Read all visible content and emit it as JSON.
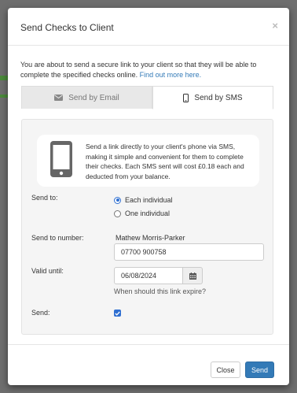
{
  "modal": {
    "title": "Send Checks to Client",
    "close_symbol": "×",
    "intro_text": "You are about to send a secure link to your client so that they will be able to complete the specified checks online.",
    "intro_link": "Find out more here."
  },
  "tabs": [
    {
      "label": "Send by Email",
      "icon": "envelope-icon",
      "active": false
    },
    {
      "label": "Send by SMS",
      "icon": "mobile-phone-icon",
      "active": true
    }
  ],
  "info": {
    "icon": "mobile-phone-icon",
    "text": "Send a link directly to your client's phone via SMS, making it simple and convenient for them to complete their checks. Each SMS sent will cost £0.18 each and deducted from your balance."
  },
  "form": {
    "send_to_label": "Send to:",
    "send_to_options": [
      {
        "label": "Each individual",
        "checked": true
      },
      {
        "label": "One individual",
        "checked": false
      }
    ],
    "send_to_number_label": "Send to number:",
    "recipient_name": "Mathew Morris-Parker",
    "phone_number": "07700 900758",
    "valid_until_label": "Valid until:",
    "valid_until_value": "06/08/2024",
    "valid_until_help": "When should this link expire?",
    "send_label": "Send:",
    "send_checked": true
  },
  "footer": {
    "close_label": "Close",
    "send_label": "Send"
  },
  "colors": {
    "primary": "#337ab7",
    "radio_accent": "#2f6fd1"
  }
}
